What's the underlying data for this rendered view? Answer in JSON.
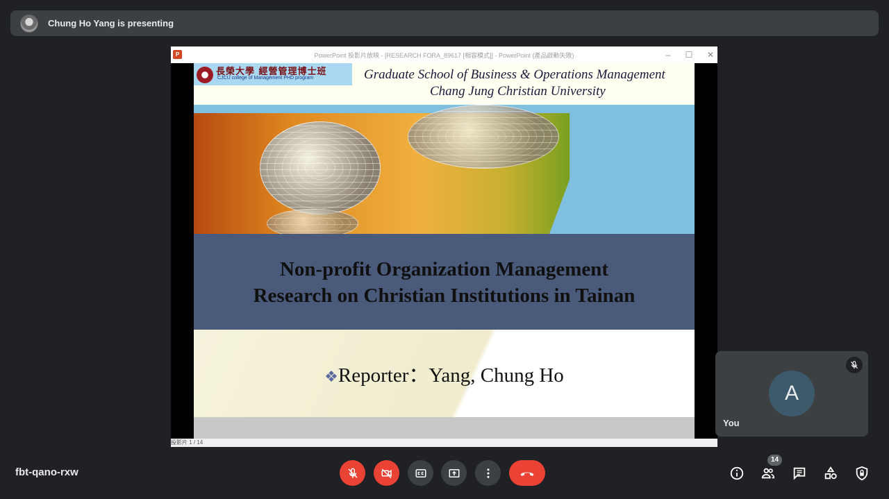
{
  "presenting_bar": {
    "text": "Chung Ho Yang is presenting"
  },
  "powerpoint": {
    "window_title": "PowerPoint 投影片放映 - [RESEARCH FORA_89617 [相容模式]] - PowerPoint (產品啟動失敗)",
    "logo": "P",
    "status": "投影片 1 / 14"
  },
  "slide": {
    "badge_cn": "長榮大學 經營管理博士班",
    "badge_en": "CJCU college of Management PHD program",
    "header_line1": "Graduate School of Business & Operations Management",
    "header_line2": "Chang Jung Christian University",
    "title_line1": "Non-profit Organization Management",
    "title_line2": "Research on Christian Institutions in Tainan",
    "reporter_bullet": "❖",
    "reporter_text": "Reporter：Yang, Chung  Ho"
  },
  "self_tile": {
    "initial": "A",
    "name": "You"
  },
  "meeting": {
    "code": "fbt-qano-rxw",
    "participant_count": "14"
  },
  "colors": {
    "end_call": "#ea4335",
    "background": "#202124",
    "tile": "#3c4043"
  }
}
